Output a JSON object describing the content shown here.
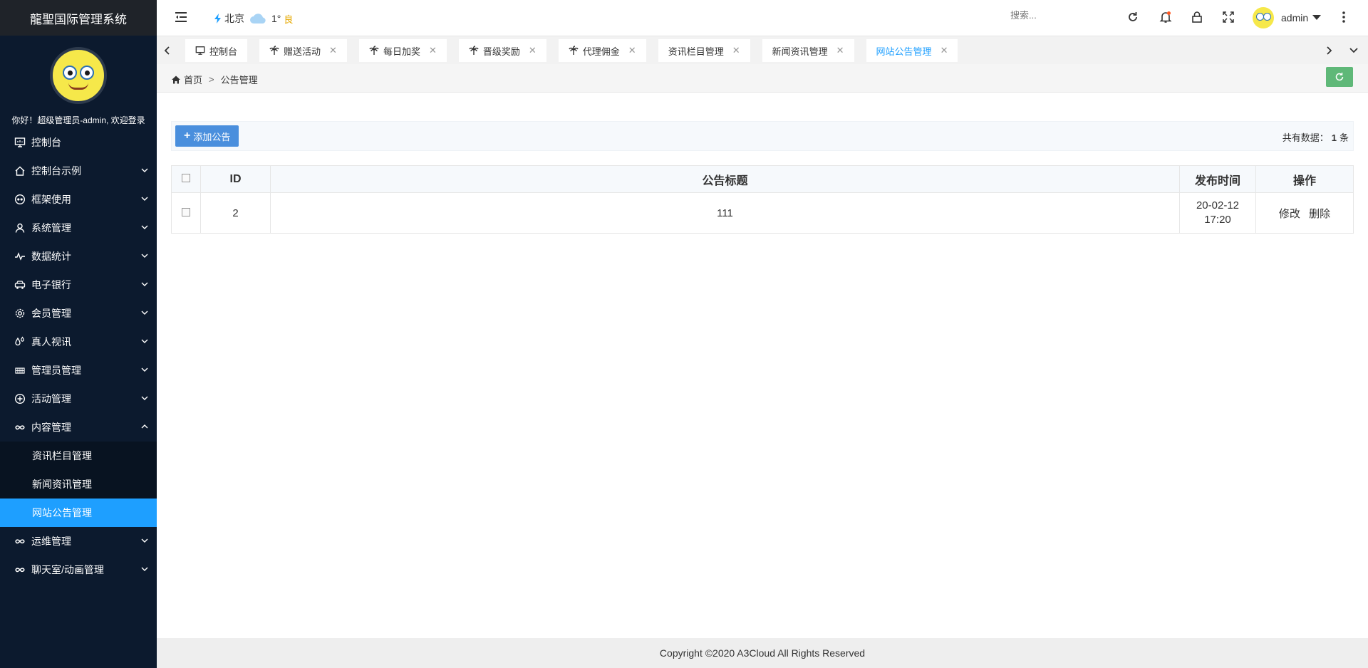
{
  "app": {
    "title": "龍聖国际管理系统",
    "welcome": "你好！超级管理员-admin, 欢迎登录"
  },
  "sidebar": {
    "items": [
      {
        "label": "控制台",
        "icon": "monitor-icon",
        "has_children": false
      },
      {
        "label": "控制台示例",
        "icon": "home-icon",
        "has_children": true
      },
      {
        "label": "框架使用",
        "icon": "glasses-icon",
        "has_children": true
      },
      {
        "label": "系统管理",
        "icon": "user-icon",
        "has_children": true
      },
      {
        "label": "数据统计",
        "icon": "pulse-icon",
        "has_children": true
      },
      {
        "label": "电子银行",
        "icon": "car-icon",
        "has_children": true
      },
      {
        "label": "会员管理",
        "icon": "gear-icon",
        "has_children": true
      },
      {
        "label": "真人视讯",
        "icon": "drops-icon",
        "has_children": true
      },
      {
        "label": "管理员管理",
        "icon": "grid-icon",
        "has_children": true
      },
      {
        "label": "活动管理",
        "icon": "plus-circle-icon",
        "has_children": true
      },
      {
        "label": "内容管理",
        "icon": "infinity-icon",
        "has_children": true,
        "expanded": true
      },
      {
        "label": "运维管理",
        "icon": "infinity-icon",
        "has_children": true
      },
      {
        "label": "聊天室/动画管理",
        "icon": "infinity-icon",
        "has_children": true
      }
    ],
    "content_sub": [
      {
        "label": "资讯栏目管理",
        "active": false
      },
      {
        "label": "新闻资讯管理",
        "active": false
      },
      {
        "label": "网站公告管理",
        "active": true
      }
    ]
  },
  "header": {
    "weather_city": "北京",
    "weather_temp": "1°",
    "weather_quality": "良",
    "search_placeholder": "搜索...",
    "user_name": "admin"
  },
  "tabs": [
    {
      "label": "控制台",
      "closable": false,
      "active": false
    },
    {
      "label": "赠送活动",
      "closable": true,
      "active": false
    },
    {
      "label": "每日加奖",
      "closable": true,
      "active": false
    },
    {
      "label": "晋级奖励",
      "closable": true,
      "active": false
    },
    {
      "label": "代理佣金",
      "closable": true,
      "active": false
    },
    {
      "label": "资讯栏目管理",
      "closable": true,
      "active": false
    },
    {
      "label": "新闻资讯管理",
      "closable": true,
      "active": false
    },
    {
      "label": "网站公告管理",
      "closable": true,
      "active": true
    }
  ],
  "breadcrumb": {
    "home": "首页",
    "separator": ">",
    "current": "公告管理"
  },
  "toolbar": {
    "add_label": "添加公告",
    "count_prefix": "共有数据：",
    "count_value": "1",
    "count_suffix": "条"
  },
  "table": {
    "headers": {
      "id": "ID",
      "title": "公告标题",
      "time": "发布时间",
      "ops": "操作"
    },
    "rows": [
      {
        "id": "2",
        "title": "111",
        "time": "20-02-12 17:20",
        "edit": "修改",
        "delete": "删除"
      }
    ]
  },
  "footer": {
    "copyright": "Copyright ©2020 A3Cloud All Rights Reserved"
  },
  "colors": {
    "sidebar_bg": "#0c1a2e",
    "active_blue": "#1e9fff",
    "refresh_green": "#5fb878",
    "add_btn": "#4a8fdd"
  }
}
